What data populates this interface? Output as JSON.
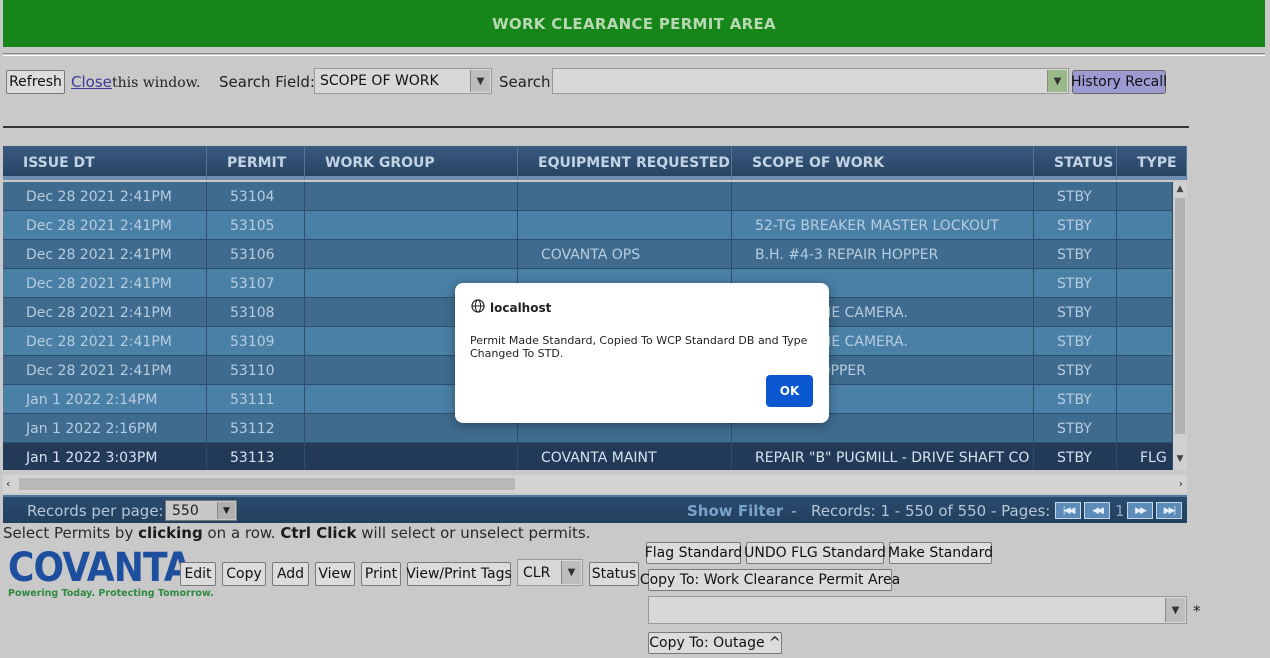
{
  "header": {
    "title": "WORK CLEARANCE PERMIT AREA"
  },
  "toolbar": {
    "refresh_label": "Refresh",
    "close_label": "Close",
    "close_suffix": "this window.",
    "search_field_label": "Search Field:",
    "search_field_value": "SCOPE OF WORK",
    "search_label": "Search",
    "search_value": "",
    "history_recall_label": "History Recall"
  },
  "grid": {
    "columns": [
      "ISSUE DT",
      "PERMIT",
      "WORK GROUP",
      "EQUIPMENT REQUESTED",
      "SCOPE OF WORK",
      "STATUS",
      "TYPE"
    ],
    "rows": [
      {
        "issue_dt": "Dec 28 2021 2:41PM",
        "permit": "53104",
        "work_group": "",
        "equipment": "",
        "scope": "",
        "status": "STBY",
        "type": ""
      },
      {
        "issue_dt": "Dec 28 2021 2:41PM",
        "permit": "53105",
        "work_group": "",
        "equipment": "",
        "scope": "52-TG BREAKER MASTER LOCKOUT",
        "status": "STBY",
        "type": ""
      },
      {
        "issue_dt": "Dec 28 2021 2:41PM",
        "permit": "53106",
        "work_group": "",
        "equipment": "COVANTA OPS",
        "scope": "B.H. #4-3 REPAIR HOPPER",
        "status": "STBY",
        "type": ""
      },
      {
        "issue_dt": "Dec 28 2021 2:41PM",
        "permit": "53107",
        "work_group": "",
        "equipment": "",
        "scope": "",
        "status": "STBY",
        "type": ""
      },
      {
        "issue_dt": "Dec 28 2021 2:41PM",
        "permit": "53108",
        "work_group": "",
        "equipment": "",
        "scope": "# 2 INCLINE CAMERA.",
        "status": "STBY",
        "type": ""
      },
      {
        "issue_dt": "Dec 28 2021 2:41PM",
        "permit": "53109",
        "work_group": "",
        "equipment": "",
        "scope": "# 2 INCLINE CAMERA.",
        "status": "STBY",
        "type": ""
      },
      {
        "issue_dt": "Dec 28 2021 2:41PM",
        "permit": "53110",
        "work_group": "",
        "equipment": "",
        "scope": "REPAIR HOPPER",
        "status": "STBY",
        "type": ""
      },
      {
        "issue_dt": "Jan 1 2022 2:14PM",
        "permit": "53111",
        "work_group": "",
        "equipment": "",
        "scope": "",
        "status": "STBY",
        "type": ""
      },
      {
        "issue_dt": "Jan 1 2022 2:16PM",
        "permit": "53112",
        "work_group": "",
        "equipment": "",
        "scope": "",
        "status": "STBY",
        "type": ""
      },
      {
        "issue_dt": "Jan 1 2022 3:03PM",
        "permit": "53113",
        "work_group": "",
        "equipment": "COVANTA MAINT",
        "scope": "REPAIR \"B\" PUGMILL - DRIVE SHAFT CO",
        "status": "STBY",
        "type": "FLG"
      }
    ]
  },
  "pager": {
    "records_per_page_label": "Records per page:",
    "records_per_page_value": "550",
    "show_filter_label": "Show Filter",
    "separator": "-",
    "records_text": "Records: 1 - 550 of 550 - Pages:",
    "current_page": "1"
  },
  "hint": {
    "part1": "Select Permits by ",
    "bold1": "clicking",
    "part2": " on a row. ",
    "bold2": "Ctrl Click",
    "part3": " will select or unselect permits."
  },
  "logo": {
    "word": "COVANTA",
    "tagline": "Powering Today. Protecting Tomorrow."
  },
  "actions": {
    "edit": "Edit",
    "copy": "Copy",
    "add": "Add",
    "view": "View",
    "print": "Print",
    "view_print_tags": "View/Print Tags",
    "status_select": "CLR",
    "status": "Status",
    "flag_standard": "Flag Standard",
    "undo_flg_standard": "UNDO FLG Standard",
    "make_standard": "Make Standard",
    "copy_to_wcp": "Copy To: Work Clearance Permit Area",
    "copy_target_value": "",
    "required_marker": "*",
    "copy_to_outage": "Copy To: Outage ^"
  },
  "dialog": {
    "origin": "localhost",
    "message": "Permit Made Standard, Copied To WCP Standard DB and Type Changed To STD.",
    "ok_label": "OK"
  },
  "colors": {
    "banner": "#16861a",
    "grid_header": "#264463",
    "row_odd": "#3e6b8e",
    "row_even": "#4a7fa6",
    "row_selected": "#223a57",
    "ok_button": "#0b57d0"
  }
}
